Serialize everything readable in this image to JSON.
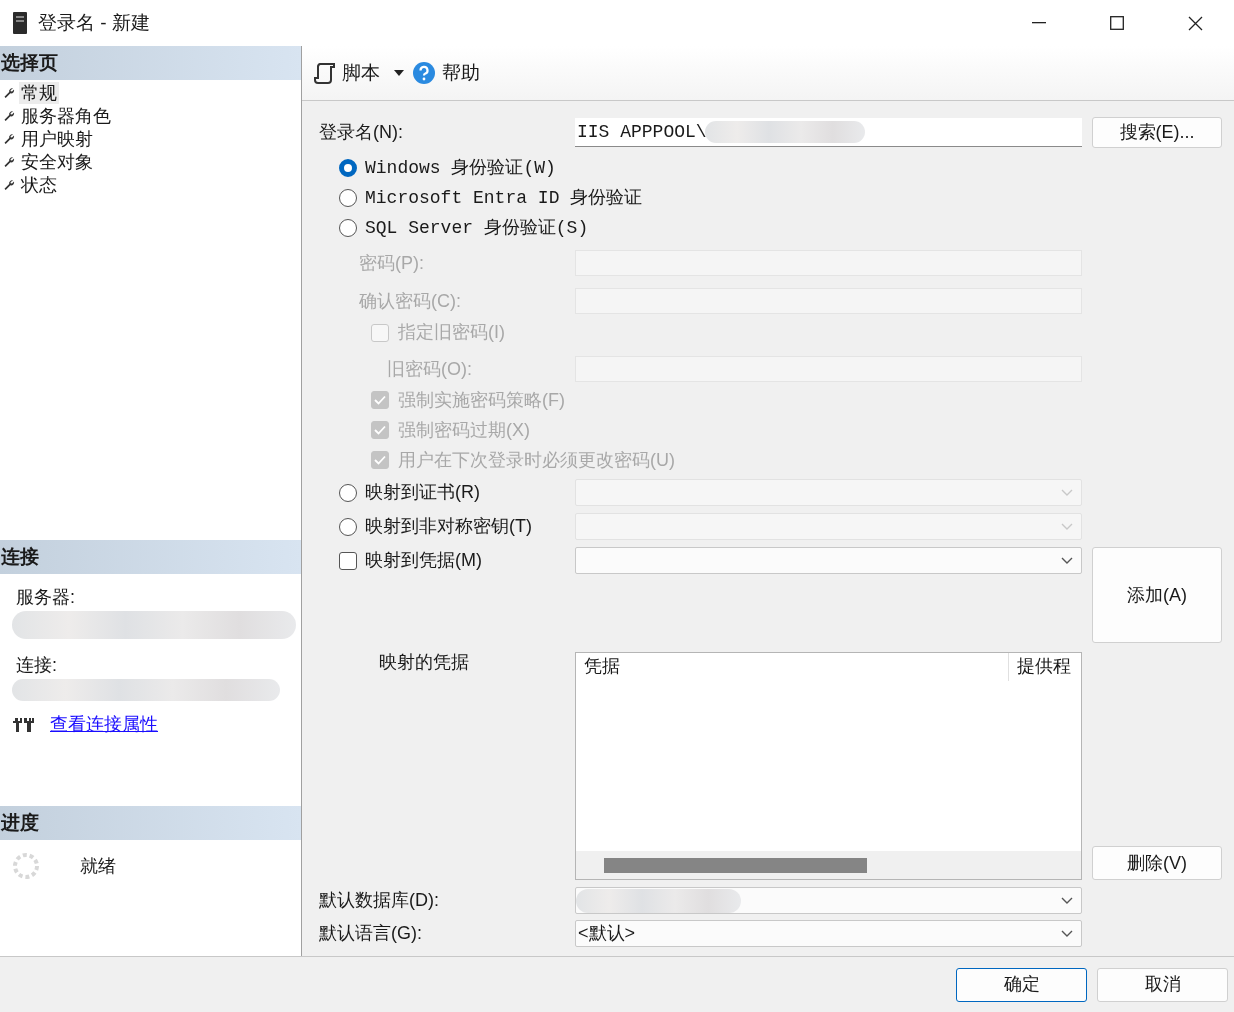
{
  "window": {
    "title": "登录名 - 新建"
  },
  "sidebar": {
    "header": "选择页",
    "pages": [
      {
        "label": "常规",
        "selected": true
      },
      {
        "label": "服务器角色",
        "selected": false
      },
      {
        "label": "用户映射",
        "selected": false
      },
      {
        "label": "安全对象",
        "selected": false
      },
      {
        "label": "状态",
        "selected": false
      }
    ]
  },
  "connection": {
    "header": "连接",
    "server_label": "服务器:",
    "connection_label": "连接:",
    "link": "查看连接属性"
  },
  "progress": {
    "header": "进度",
    "status": "就绪"
  },
  "toolbar": {
    "script": "脚本",
    "help": "帮助"
  },
  "login": {
    "label": "登录名(N):",
    "value": "IIS APPPOOL\\",
    "search_button": "搜索(E)..."
  },
  "auth_options": [
    {
      "label": "Windows 身份验证(W)",
      "selected": true
    },
    {
      "label": "Microsoft Entra ID 身份验证",
      "selected": false
    },
    {
      "label": "SQL Server 身份验证(S)",
      "selected": false
    }
  ],
  "password_fields": [
    {
      "label": "密码(P):",
      "disabled": true
    },
    {
      "label": "确认密码(C):",
      "disabled": true
    }
  ],
  "old_password": {
    "label": "指定旧密码(I)",
    "checked": false,
    "disabled": true,
    "field_label": "旧密码(O):"
  },
  "policies": [
    {
      "label": "强制实施密码策略(F)",
      "checked": true,
      "disabled": true
    },
    {
      "label": "强制密码过期(X)",
      "checked": true,
      "disabled": true
    },
    {
      "label": "用户在下次登录时必须更改密码(U)",
      "checked": true,
      "disabled": true
    }
  ],
  "mappings": [
    {
      "kind": "radio",
      "label": "映射到证书(R)",
      "selected": false,
      "disabled": true
    },
    {
      "kind": "radio",
      "label": "映射到非对称密钥(T)",
      "selected": false,
      "disabled": true
    },
    {
      "kind": "checkbox",
      "label": "映射到凭据(M)",
      "checked": false,
      "disabled": false
    }
  ],
  "add_button": "添加(A)",
  "credentials": {
    "label": "映射的凭据",
    "columns": [
      "凭据",
      "提供程"
    ]
  },
  "remove_button": "删除(V)",
  "default_database": {
    "label": "默认数据库(D):"
  },
  "default_language": {
    "label": "默认语言(G):",
    "value": "<默认>"
  },
  "footer": {
    "ok": "确定",
    "cancel": "取消"
  }
}
